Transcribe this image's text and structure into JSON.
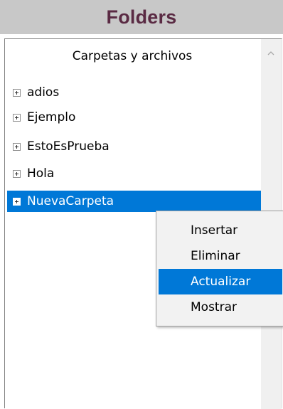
{
  "header": {
    "title": "Folders"
  },
  "tree": {
    "title": "Carpetas y archivos",
    "items": [
      {
        "label": "adios"
      },
      {
        "label": "Ejemplo"
      },
      {
        "label": "EstoEsPrueba"
      },
      {
        "label": "Hola"
      },
      {
        "label": "NuevaCarpeta",
        "selected": true
      }
    ]
  },
  "context_menu": {
    "items": [
      {
        "label": "Insertar"
      },
      {
        "label": "Eliminar"
      },
      {
        "label": "Actualizar",
        "highlighted": true
      },
      {
        "label": "Mostrar"
      }
    ]
  },
  "colors": {
    "header_background": "#c8c8c8",
    "header_text": "#5a2a43",
    "selection": "#0078d7"
  }
}
